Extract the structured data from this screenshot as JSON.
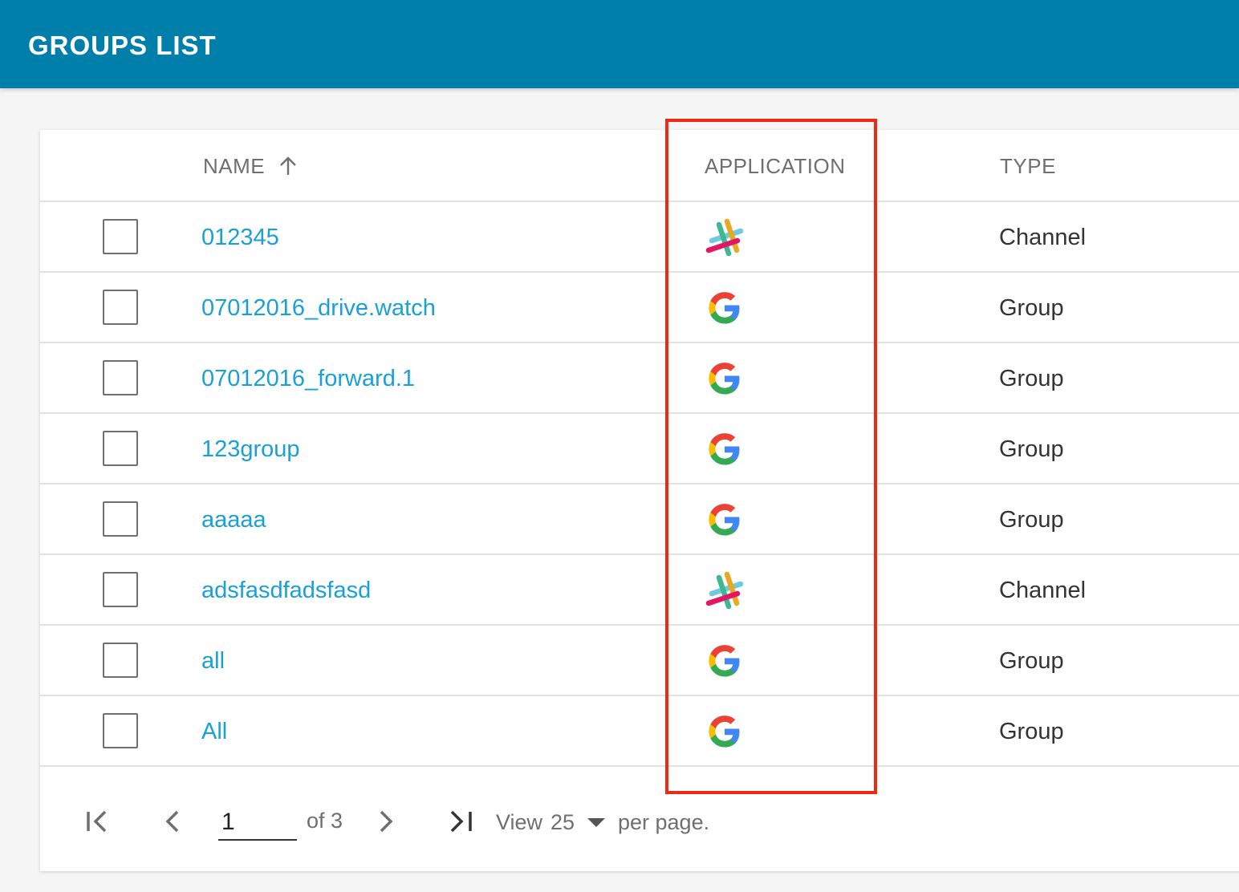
{
  "header": {
    "title": "GROUPS LIST"
  },
  "table": {
    "columns": {
      "name": "NAME",
      "application": "APPLICATION",
      "type": "TYPE"
    },
    "rows": [
      {
        "name": "012345",
        "application": "slack",
        "type": "Channel"
      },
      {
        "name": "07012016_drive.watch",
        "application": "google",
        "type": "Group"
      },
      {
        "name": "07012016_forward.1",
        "application": "google",
        "type": "Group"
      },
      {
        "name": "123group",
        "application": "google",
        "type": "Group"
      },
      {
        "name": "aaaaa",
        "application": "google",
        "type": "Group"
      },
      {
        "name": "adsfasdfadsfasd",
        "application": "slack",
        "type": "Channel"
      },
      {
        "name": "all",
        "application": "google",
        "type": "Group"
      },
      {
        "name": "All",
        "application": "google",
        "type": "Group"
      }
    ]
  },
  "pagination": {
    "current_page": "1",
    "of_label": "of 3",
    "view_label": "View",
    "per_page": "25",
    "per_page_suffix": "per page."
  },
  "icons": {
    "sort": "arrow-up-icon",
    "first_page": "first-page-icon",
    "prev_page": "chevron-left-icon",
    "next_page": "chevron-right-icon",
    "last_page": "last-page-icon",
    "dropdown": "caret-down-icon",
    "slack": "slack-icon",
    "google": "google-icon"
  },
  "colors": {
    "header_bg": "#017fab",
    "link": "#1aa0d8",
    "highlight": "#ee2a14",
    "google_blue": "#4285F4",
    "google_red": "#EA4335",
    "google_yellow": "#FBBC05",
    "google_green": "#34A853"
  }
}
